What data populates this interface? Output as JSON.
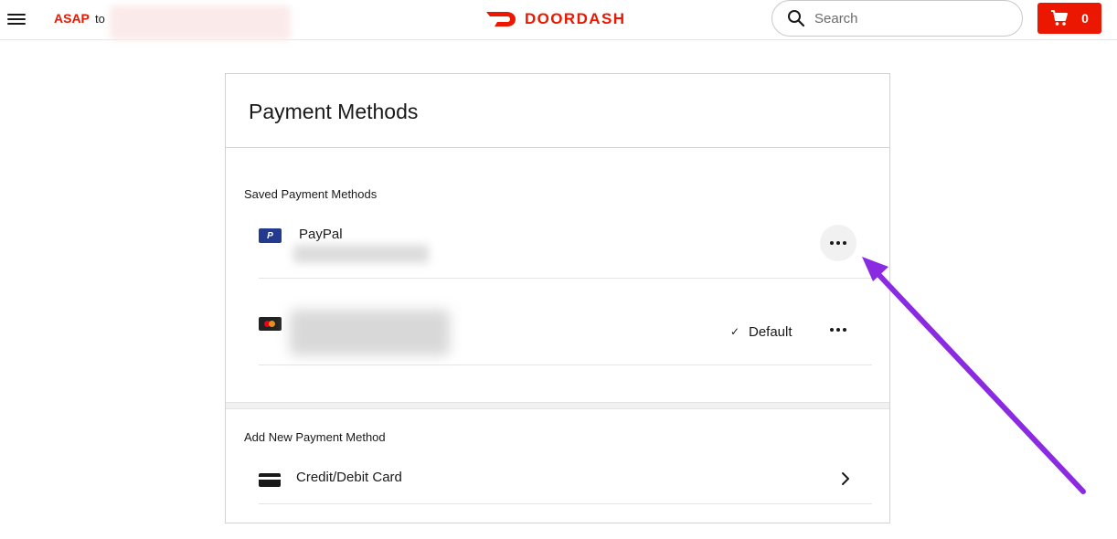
{
  "header": {
    "asap_label": "ASAP",
    "to_label": "to",
    "logo_text": "DOORDASH",
    "search_placeholder": "Search",
    "cart_count": "0"
  },
  "page": {
    "title": "Payment Methods",
    "saved_section_label": "Saved Payment Methods",
    "saved_methods": [
      {
        "label": "PayPal",
        "icon": "paypal-icon"
      },
      {
        "label": "",
        "icon": "mastercard-icon",
        "status": "Default"
      }
    ],
    "add_section_label": "Add New Payment Method",
    "add_option_label": "Credit/Debit Card"
  },
  "colors": {
    "brand": "#eb1700",
    "annotation_arrow": "#8a2be2"
  }
}
